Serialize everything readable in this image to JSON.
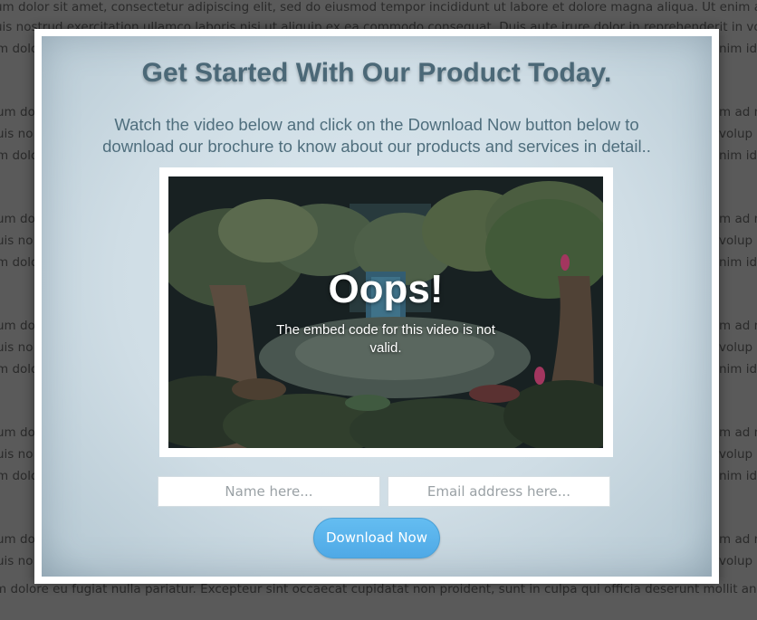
{
  "background_text": {
    "line_top_partial": "um dolor sit amet, consectetur adipiscing elit, sed do eiusmod tempor incididunt ut labore et dolore magna aliqua. Ut enim ad m",
    "line_top_full": "uis nostrud exercitation ullamco laboris nisi ut aliquip ex ea commodo consequat. Duis aute irure dolor in reprehenderit in volup",
    "line_bottom_full": "m dolore eu fugiat nulla pariatur. Excepteur sint occaecat cupidatat non proident, sunt in culpa qui officia deserunt mollit anim id",
    "left_fragments": [
      "m dolo",
      "um do",
      "uis no",
      "m dolo",
      "um do",
      "uis no",
      "m dolo",
      "um do",
      "uis no",
      "m dolo",
      "um do",
      "uis no",
      "m dolo",
      "um do",
      "uis no"
    ],
    "right_fragments": [
      "nim id",
      "m ad m",
      "volup",
      "nim id",
      "m ad m",
      "volup",
      "nim id",
      "m ad m",
      "volup",
      "nim id",
      "m ad m",
      "volup",
      "nim id",
      "m ad m",
      "volup"
    ]
  },
  "modal": {
    "title": "Get Started With Our Product Today.",
    "subtitle": "Watch the video below and click on the Download Now button below to download our brochure to know about our products and services in detail..",
    "video": {
      "error_title": "Oops!",
      "error_message": "The embed code for this video is not valid."
    },
    "form": {
      "name_placeholder": "Name here...",
      "email_placeholder": "Email address here...",
      "download_label": "Download Now"
    }
  },
  "colors": {
    "title": "#4b6877",
    "button": "#56b0ea",
    "modal_bg": "#d4e2ea"
  }
}
